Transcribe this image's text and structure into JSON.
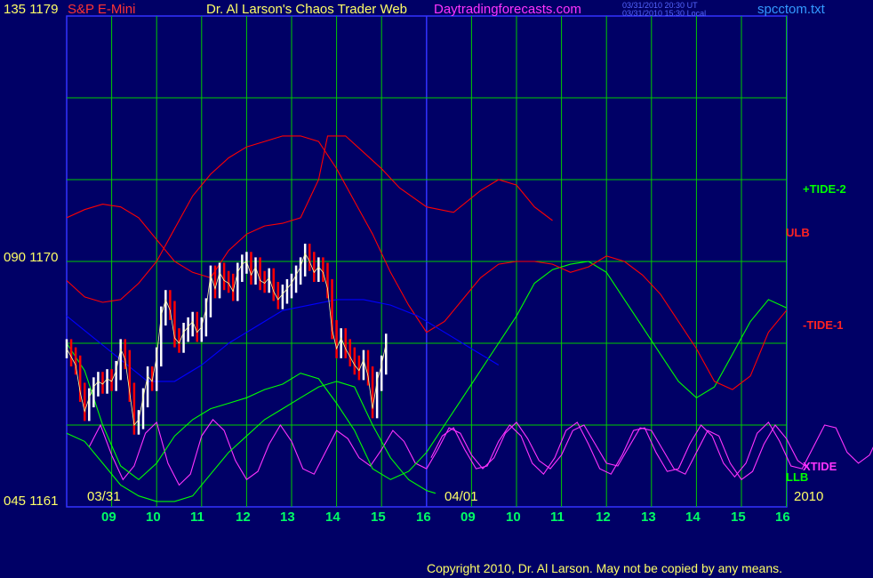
{
  "header": {
    "left_price": "135 1179",
    "symbol": "S&P E-Mini",
    "title": "Dr. Al Larson's Chaos Trader Web",
    "site": "Daytradingforecasts.com",
    "timestamp_ut": "03/31/2010 20:30 UT",
    "timestamp_local": "03/31/2010 15:30 Local",
    "filename": "spcctom.txt"
  },
  "footer": {
    "copyright": "Copyright 2010, Dr. Al Larson. May not be copied by any means."
  },
  "colors": {
    "background": "#000066",
    "grid": "#00cc00",
    "frame": "#3333ff",
    "price_up": "#ffffff",
    "price_down": "#ff0000",
    "tide_plus": "#00ff00",
    "tide_minus": "#ff0000",
    "xtide": "#ff33ff",
    "average": "#0000ff",
    "label_yellow": "#ffff66",
    "symbol_red": "#ff3333",
    "site_magenta": "#ff33ff",
    "filename_blue": "#3399ff"
  },
  "chart_data": {
    "type": "line",
    "ylim": [
      1161,
      1179
    ],
    "y_ticks": [
      {
        "value": 1179,
        "label": "135 1179"
      },
      {
        "value": 1170,
        "label": "090 1170"
      },
      {
        "value": 1161,
        "label": "045 1161"
      }
    ],
    "x_tick_labels": [
      "09",
      "10",
      "11",
      "12",
      "13",
      "14",
      "15",
      "16",
      "09",
      "10",
      "11",
      "12",
      "13",
      "14",
      "15",
      "16"
    ],
    "date_labels": [
      "03/31",
      "04/01",
      "2010"
    ],
    "series_labels": [
      "+TIDE-2",
      "ULB",
      "-TIDE-1",
      "XTIDE",
      "LLB"
    ],
    "x_range_hours": [
      0,
      16
    ],
    "price_close": [
      [
        0.0,
        1166.8
      ],
      [
        0.1,
        1166.5
      ],
      [
        0.2,
        1166.2
      ],
      [
        0.3,
        1165.2
      ],
      [
        0.4,
        1164.5
      ],
      [
        0.5,
        1165.0
      ],
      [
        0.6,
        1165.4
      ],
      [
        0.7,
        1165.6
      ],
      [
        0.8,
        1165.5
      ],
      [
        0.9,
        1165.7
      ],
      [
        1.0,
        1165.6
      ],
      [
        1.1,
        1166.0
      ],
      [
        1.2,
        1166.8
      ],
      [
        1.3,
        1166.4
      ],
      [
        1.4,
        1165.2
      ],
      [
        1.5,
        1164.0
      ],
      [
        1.6,
        1164.2
      ],
      [
        1.7,
        1165.0
      ],
      [
        1.8,
        1165.8
      ],
      [
        1.9,
        1165.6
      ],
      [
        2.0,
        1166.5
      ],
      [
        2.1,
        1168.0
      ],
      [
        2.2,
        1168.6
      ],
      [
        2.3,
        1168.2
      ],
      [
        2.4,
        1167.2
      ],
      [
        2.5,
        1167.0
      ],
      [
        2.6,
        1167.4
      ],
      [
        2.7,
        1167.6
      ],
      [
        2.8,
        1167.8
      ],
      [
        2.9,
        1167.4
      ],
      [
        3.0,
        1167.6
      ],
      [
        3.1,
        1168.3
      ],
      [
        3.2,
        1169.5
      ],
      [
        3.3,
        1169.0
      ],
      [
        3.4,
        1169.6
      ],
      [
        3.5,
        1169.3
      ],
      [
        3.6,
        1169.2
      ],
      [
        3.7,
        1168.9
      ],
      [
        3.8,
        1169.6
      ],
      [
        3.9,
        1169.9
      ],
      [
        4.0,
        1170.0
      ],
      [
        4.1,
        1169.5
      ],
      [
        4.2,
        1169.8
      ],
      [
        4.3,
        1169.3
      ],
      [
        4.4,
        1169.2
      ],
      [
        4.5,
        1169.4
      ],
      [
        4.6,
        1168.9
      ],
      [
        4.7,
        1168.6
      ],
      [
        4.8,
        1168.8
      ],
      [
        4.9,
        1169.0
      ],
      [
        5.0,
        1169.2
      ],
      [
        5.1,
        1169.5
      ],
      [
        5.2,
        1169.8
      ],
      [
        5.3,
        1170.3
      ],
      [
        5.4,
        1170.0
      ],
      [
        5.5,
        1169.6
      ],
      [
        5.6,
        1169.8
      ],
      [
        5.7,
        1169.6
      ],
      [
        5.8,
        1169.0
      ],
      [
        5.9,
        1167.5
      ],
      [
        6.0,
        1166.8
      ],
      [
        6.1,
        1167.2
      ],
      [
        6.2,
        1166.8
      ],
      [
        6.3,
        1166.5
      ],
      [
        6.4,
        1166.2
      ],
      [
        6.5,
        1166.0
      ],
      [
        6.6,
        1166.4
      ],
      [
        6.7,
        1165.8
      ],
      [
        6.8,
        1164.6
      ],
      [
        6.9,
        1165.6
      ],
      [
        7.0,
        1166.2
      ],
      [
        7.1,
        1167.0
      ]
    ],
    "tide_plus_2": [
      [
        0,
        1167.0
      ],
      [
        0.4,
        1166.0
      ],
      [
        0.8,
        1164.0
      ],
      [
        1.2,
        1162.5
      ],
      [
        1.6,
        1162.0
      ],
      [
        2.0,
        1162.6
      ],
      [
        2.4,
        1163.6
      ],
      [
        2.8,
        1164.2
      ],
      [
        3.2,
        1164.6
      ],
      [
        3.6,
        1164.8
      ],
      [
        4.0,
        1165.0
      ],
      [
        4.4,
        1165.3
      ],
      [
        4.8,
        1165.5
      ],
      [
        5.2,
        1165.9
      ],
      [
        5.6,
        1165.7
      ],
      [
        6.0,
        1164.8
      ],
      [
        6.4,
        1163.8
      ],
      [
        6.8,
        1162.4
      ],
      [
        7.2,
        1162.0
      ],
      [
        7.6,
        1162.3
      ],
      [
        8.0,
        1163.0
      ],
      [
        8.4,
        1164.0
      ],
      [
        8.8,
        1165.0
      ],
      [
        9.2,
        1166.0
      ],
      [
        9.6,
        1167.0
      ],
      [
        10.0,
        1168.0
      ],
      [
        10.4,
        1169.2
      ],
      [
        10.8,
        1169.7
      ],
      [
        11.2,
        1169.9
      ],
      [
        11.6,
        1170.0
      ],
      [
        12.0,
        1169.6
      ],
      [
        12.4,
        1168.6
      ],
      [
        12.8,
        1167.6
      ],
      [
        13.2,
        1166.6
      ],
      [
        13.6,
        1165.6
      ],
      [
        14.0,
        1165.0
      ],
      [
        14.4,
        1165.4
      ],
      [
        14.8,
        1166.6
      ],
      [
        15.2,
        1167.8
      ],
      [
        15.6,
        1168.6
      ],
      [
        16.0,
        1168.3
      ]
    ],
    "tide_minus_1": [
      [
        0,
        1169.3
      ],
      [
        0.4,
        1168.7
      ],
      [
        0.8,
        1168.5
      ],
      [
        1.2,
        1168.6
      ],
      [
        1.6,
        1169.2
      ],
      [
        2.0,
        1170.0
      ],
      [
        2.4,
        1171.2
      ],
      [
        2.8,
        1172.4
      ],
      [
        3.2,
        1173.2
      ],
      [
        3.6,
        1173.8
      ],
      [
        4.0,
        1174.2
      ],
      [
        4.4,
        1174.4
      ],
      [
        4.8,
        1174.6
      ],
      [
        5.2,
        1174.6
      ],
      [
        5.6,
        1174.4
      ],
      [
        6.0,
        1173.4
      ],
      [
        6.4,
        1172.2
      ],
      [
        6.8,
        1171.0
      ],
      [
        7.2,
        1169.6
      ],
      [
        7.6,
        1168.4
      ],
      [
        8.0,
        1167.4
      ],
      [
        8.4,
        1167.8
      ],
      [
        8.8,
        1168.6
      ],
      [
        9.2,
        1169.4
      ],
      [
        9.6,
        1169.9
      ],
      [
        10.0,
        1170.0
      ],
      [
        10.4,
        1170.0
      ],
      [
        10.8,
        1169.9
      ],
      [
        11.2,
        1169.6
      ],
      [
        11.6,
        1169.8
      ],
      [
        12.0,
        1170.2
      ],
      [
        12.4,
        1170.0
      ],
      [
        12.8,
        1169.5
      ],
      [
        13.2,
        1168.8
      ],
      [
        13.6,
        1167.8
      ],
      [
        14.0,
        1166.8
      ],
      [
        14.4,
        1165.6
      ],
      [
        14.8,
        1165.3
      ],
      [
        15.2,
        1165.8
      ],
      [
        15.6,
        1167.4
      ],
      [
        16.0,
        1168.2
      ]
    ],
    "upper_band": [
      [
        0,
        1171.6
      ],
      [
        0.4,
        1171.9
      ],
      [
        0.8,
        1172.1
      ],
      [
        1.2,
        1172.0
      ],
      [
        1.6,
        1171.6
      ],
      [
        2.0,
        1170.8
      ],
      [
        2.4,
        1170.0
      ],
      [
        2.8,
        1169.6
      ],
      [
        3.2,
        1169.4
      ],
      [
        3.6,
        1170.4
      ],
      [
        4.0,
        1171.0
      ],
      [
        4.4,
        1171.3
      ],
      [
        4.8,
        1171.4
      ],
      [
        5.2,
        1171.6
      ],
      [
        5.6,
        1173.0
      ],
      [
        5.8,
        1174.6
      ],
      [
        6.2,
        1174.6
      ],
      [
        6.6,
        1174.0
      ],
      [
        7.0,
        1173.4
      ],
      [
        7.4,
        1172.7
      ],
      [
        8.0,
        1172.0
      ],
      [
        8.6,
        1171.8
      ],
      [
        9.2,
        1172.6
      ],
      [
        9.6,
        1173.0
      ],
      [
        10.0,
        1172.8
      ],
      [
        10.4,
        1172.0
      ],
      [
        10.8,
        1171.5
      ]
    ],
    "lower_band": [
      [
        0,
        1163.7
      ],
      [
        0.4,
        1163.4
      ],
      [
        0.8,
        1162.6
      ],
      [
        1.2,
        1161.8
      ],
      [
        1.6,
        1161.4
      ],
      [
        2.0,
        1161.2
      ],
      [
        2.4,
        1161.2
      ],
      [
        2.8,
        1161.4
      ],
      [
        3.2,
        1162.2
      ],
      [
        3.6,
        1163.0
      ],
      [
        4.0,
        1163.6
      ],
      [
        4.4,
        1164.2
      ],
      [
        4.8,
        1164.6
      ],
      [
        5.2,
        1165.0
      ],
      [
        5.6,
        1165.4
      ],
      [
        6.0,
        1165.6
      ],
      [
        6.4,
        1165.4
      ],
      [
        6.8,
        1164.0
      ],
      [
        7.2,
        1162.8
      ],
      [
        7.6,
        1162.0
      ],
      [
        8.0,
        1161.6
      ],
      [
        8.2,
        1161.5
      ]
    ],
    "average": [
      [
        0,
        1168.0
      ],
      [
        0.6,
        1167.2
      ],
      [
        1.2,
        1166.4
      ],
      [
        1.8,
        1165.6
      ],
      [
        2.4,
        1165.6
      ],
      [
        3.0,
        1166.2
      ],
      [
        3.6,
        1167.0
      ],
      [
        4.2,
        1167.6
      ],
      [
        4.8,
        1168.2
      ],
      [
        5.4,
        1168.4
      ],
      [
        6.0,
        1168.6
      ],
      [
        6.6,
        1168.6
      ],
      [
        7.2,
        1168.4
      ],
      [
        7.8,
        1168.0
      ],
      [
        8.4,
        1167.4
      ],
      [
        9.0,
        1166.8
      ],
      [
        9.6,
        1166.2
      ]
    ],
    "xtide": {
      "baseline": 1163.3,
      "points_per_hour": 4,
      "values": [
        1163.2,
        1164.0,
        1162.9,
        1162.0,
        1162.5,
        1163.7,
        1164.1,
        1162.6,
        1161.8,
        1162.2,
        1163.6,
        1164.2,
        1163.8,
        1162.7,
        1162.0,
        1162.3,
        1163.3,
        1164.0,
        1163.4,
        1162.4,
        1162.2,
        1163.0,
        1163.8,
        1163.5,
        1162.8,
        1162.5,
        1163.1,
        1163.8,
        1163.4,
        1162.6,
        1162.4,
        1163.1,
        1163.9,
        1163.7,
        1162.9,
        1162.4,
        1162.8,
        1163.7,
        1164.1,
        1163.5,
        1162.7,
        1162.4,
        1162.9,
        1163.8,
        1164.0,
        1163.3,
        1162.6,
        1162.5,
        1163.2,
        1163.9,
        1163.8,
        1163.1,
        1162.4,
        1162.2,
        1163.0,
        1163.8,
        1163.6,
        1162.6,
        1162.0,
        1162.3,
        1163.3,
        1164.0,
        1163.5,
        1162.7,
        1162.4
      ],
      "values_day2": [
        1162.8,
        1163.6,
        1163.9,
        1163.1,
        1162.4,
        1162.5,
        1163.4,
        1164.0,
        1163.6,
        1162.6,
        1162.2,
        1162.8,
        1163.8,
        1164.1,
        1163.3,
        1162.4,
        1162.2,
        1162.9,
        1163.8,
        1163.9,
        1163.0,
        1162.3,
        1162.4,
        1163.3,
        1164.0,
        1163.6,
        1162.6,
        1162.1,
        1162.6,
        1163.7,
        1164.1,
        1163.4,
        1162.5,
        1162.4,
        1163.2,
        1164.0,
        1163.9,
        1163.0,
        1162.6,
        1162.9,
        1163.8,
        1164.3,
        1163.6,
        1162.6,
        1162.2,
        1162.8
      ]
    }
  }
}
